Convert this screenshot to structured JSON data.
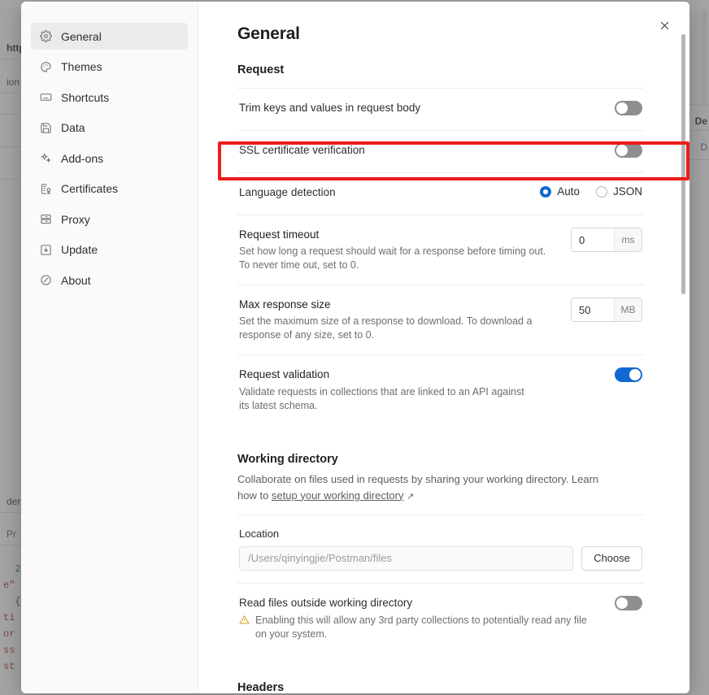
{
  "background": {
    "url_fragment": "http",
    "sub_fragment": "ion",
    "header_fragment": "der",
    "pre_fragment": "Pr",
    "right_fragments": [
      "De",
      "D"
    ],
    "code_lines": [
      "  2",
      "e\"",
      "  {",
      "ti",
      "or",
      "ss",
      "st"
    ]
  },
  "modal": {
    "close_icon": "close-icon",
    "sidebar": {
      "items": [
        {
          "label": "General",
          "icon": "gear-icon",
          "active": true
        },
        {
          "label": "Themes",
          "icon": "palette-icon",
          "active": false
        },
        {
          "label": "Shortcuts",
          "icon": "keyboard-icon",
          "active": false
        },
        {
          "label": "Data",
          "icon": "save-disk-icon",
          "active": false
        },
        {
          "label": "Add-ons",
          "icon": "sparkle-icon",
          "active": false
        },
        {
          "label": "Certificates",
          "icon": "certificate-icon",
          "active": false
        },
        {
          "label": "Proxy",
          "icon": "server-icon",
          "active": false
        },
        {
          "label": "Update",
          "icon": "download-icon",
          "active": false
        },
        {
          "label": "About",
          "icon": "info-circle-icon",
          "active": false
        }
      ]
    },
    "page_title": "General",
    "sections": {
      "request": {
        "title": "Request",
        "trim": {
          "label": "Trim keys and values in request body",
          "toggle_state": "off"
        },
        "ssl": {
          "label": "SSL certificate verification",
          "toggle_state": "off",
          "highlighted": true
        },
        "language_detection": {
          "label": "Language detection",
          "options": [
            "Auto",
            "JSON"
          ],
          "selected": "Auto"
        },
        "request_timeout": {
          "label": "Request timeout",
          "description": "Set how long a request should wait for a response before timing out. To never time out, set to 0.",
          "value": "0",
          "unit": "ms"
        },
        "max_response_size": {
          "label": "Max response size",
          "description": "Set the maximum size of a response to download. To download a response of any size, set to 0.",
          "value": "50",
          "unit": "MB"
        },
        "request_validation": {
          "label": "Request validation",
          "description": "Validate requests in collections that are linked to an API against its latest schema.",
          "toggle_state": "on"
        }
      },
      "working_directory": {
        "title": "Working directory",
        "description_before": "Collaborate on files used in requests by sharing your working directory. Learn how to ",
        "link_text": "setup your working directory",
        "link_arrow": "↗",
        "location": {
          "label": "Location",
          "value": "",
          "placeholder": "/Users/qinyingjie/Postman/files",
          "choose_label": "Choose"
        },
        "read_outside": {
          "label": "Read files outside working directory",
          "warning_icon": "warning-triangle-icon",
          "warning": "Enabling this will allow any 3rd party collections to potentially read any file on your system.",
          "toggle_state": "off"
        }
      },
      "headers": {
        "title": "Headers"
      }
    }
  },
  "colors": {
    "accent": "#1268d1",
    "highlight": "#ee1b1b",
    "toggle_off": "#8e8e8e",
    "warning": "#d9a520"
  }
}
